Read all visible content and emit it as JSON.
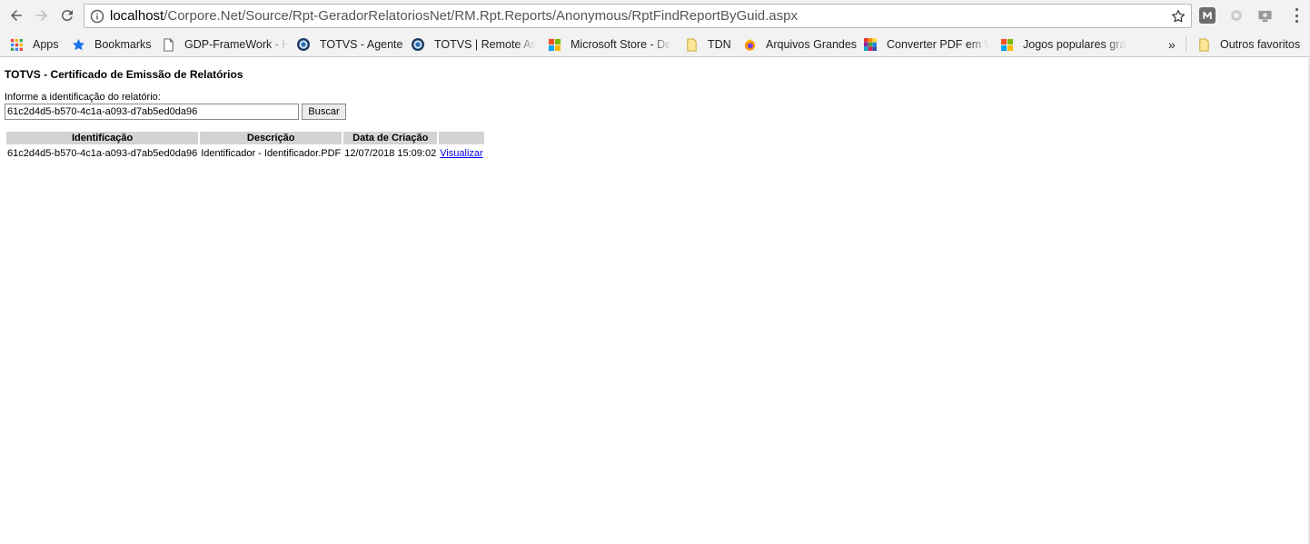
{
  "browser": {
    "url_host": "localhost",
    "url_path": "/Corpore.Net/Source/Rpt-GeradorRelatoriosNet/RM.Rpt.Reports/Anonymous/RptFindReportByGuid.aspx",
    "icons": {
      "back": "back-arrow-icon",
      "forward": "forward-arrow-icon",
      "reload": "reload-icon",
      "info": "info-icon",
      "star": "star-icon",
      "menu": "menu-dots-icon"
    }
  },
  "bookmarks": {
    "items": [
      {
        "label": "Apps",
        "icon": "apps-grid-icon"
      },
      {
        "label": "Bookmarks",
        "icon": "star-icon"
      },
      {
        "label": "GDP-FrameWork - H",
        "icon": "page-icon"
      },
      {
        "label": "TOTVS - Agente",
        "icon": "globe-icon"
      },
      {
        "label": "TOTVS | Remote Ass",
        "icon": "globe-icon"
      },
      {
        "label": "Microsoft Store - De",
        "icon": "microsoft-icon"
      },
      {
        "label": "TDN",
        "icon": "folder-icon"
      },
      {
        "label": "Arquivos Grandes",
        "icon": "firefox-icon"
      },
      {
        "label": "Converter PDF em W",
        "icon": "colorful-grid-icon"
      },
      {
        "label": "Jogos populares grat",
        "icon": "microsoft-icon"
      }
    ],
    "overflow": "»",
    "other_favorites": "Outros favoritos"
  },
  "page": {
    "title": "TOTVS - Certificado de Emissão de Relatórios",
    "prompt": "Informe a identificação do relatório:",
    "guid_value": "61c2d4d5-b570-4c1a-a093-d7ab5ed0da96",
    "search_label": "Buscar",
    "table": {
      "headers": [
        "Identificação",
        "Descrição",
        "Data de Criação",
        ""
      ],
      "rows": [
        {
          "id": "61c2d4d5-b570-4c1a-a093-d7ab5ed0da96",
          "description": "Identificador - Identificador.PDF",
          "created": "12/07/2018 15:09:02",
          "link": "Visualizar"
        }
      ]
    }
  }
}
